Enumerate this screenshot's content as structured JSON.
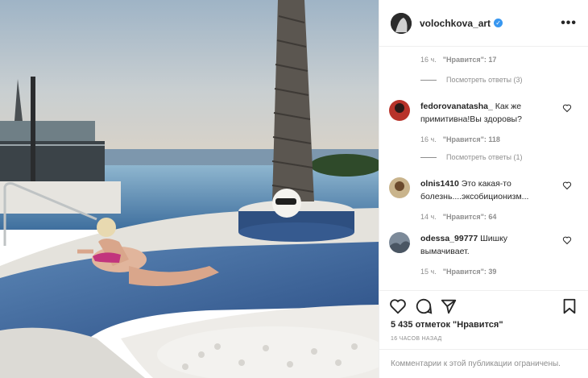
{
  "post": {
    "username": "volochkova_art",
    "more_icon": "more-horizontal-icon"
  },
  "comments": [
    {
      "time": "16 ч.",
      "like_label": "\"Нравится\": 17",
      "replies": "Посмотреть ответы (3)"
    },
    {
      "user": "fedorovanatasha_",
      "text": "Как же примитивна!Вы здоровы?",
      "time": "16 ч.",
      "like_label": "\"Нравится\": 118",
      "replies": "Посмотреть ответы (1)"
    },
    {
      "user": "olnis1410",
      "text": "Это какая-то болезнь....эксобиционизм...",
      "time": "14 ч.",
      "like_label": "\"Нравится\": 64"
    },
    {
      "user": "odessa_99777",
      "text": "Шишку вымачивает.",
      "time": "15 ч.",
      "like_label": "\"Нравится\": 39"
    }
  ],
  "footer": {
    "likes": "5 435 отметок \"Нравится\"",
    "ago": "16 ЧАСОВ НАЗАД",
    "comments_closed": "Комментарии к этой публикации ограничены."
  },
  "colors": {
    "verified": "#3897f0",
    "secondary_text": "#8e8e8e"
  }
}
